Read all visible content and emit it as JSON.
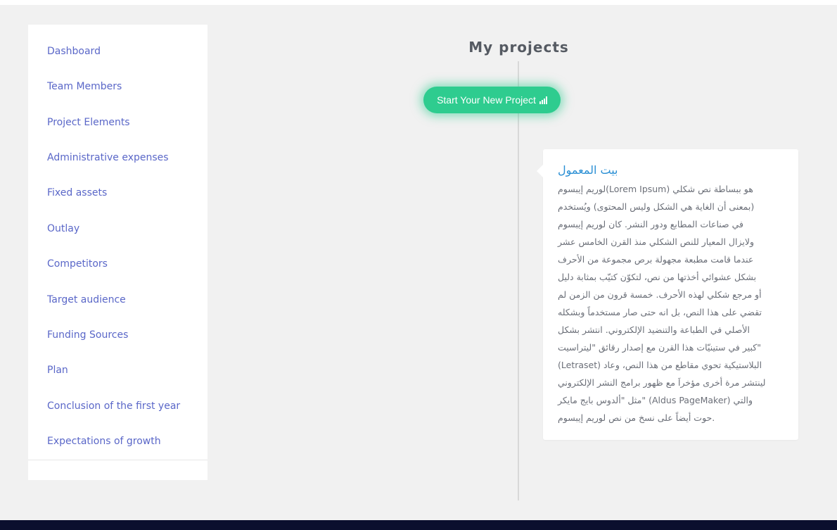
{
  "sidebar": {
    "items": [
      {
        "label": "Dashboard"
      },
      {
        "label": "Team Members"
      },
      {
        "label": "Project Elements"
      },
      {
        "label": "Administrative expenses"
      },
      {
        "label": "Fixed assets"
      },
      {
        "label": "Outlay"
      },
      {
        "label": "Competitors"
      },
      {
        "label": "Target audience"
      },
      {
        "label": "Funding Sources"
      },
      {
        "label": "Plan"
      },
      {
        "label": "Conclusion of the first year"
      },
      {
        "label": "Expectations of growth"
      }
    ]
  },
  "main": {
    "title": "My projects",
    "new_project_button": {
      "label": "Start Your New Project",
      "icon": "bar-chart-icon"
    },
    "project_card": {
      "title": "بيت المعمول",
      "body_lines": [
        "هو ببساطة نص شكلي (Lorem Ipsum)لوريم إيبسوم",
        "(بمعنى أن الغاية هي الشكل وليس المحتوى) ويُستخدم",
        "في صناعات المطابع ودور النشر. كان لوريم إيبسوم",
        "ولايزال المعيار للنص الشكلي منذ القرن الخامس عشر",
        "عندما قامت مطبعة مجهولة برص مجموعة من الأحرف",
        "بشكل عشوائي أخذتها من نص، لتكوّن كتيّب بمثابة دليل",
        "أو مرجع شكلي لهذه الأحرف. خمسة قرون من الزمن لم",
        "تقضي على هذا النص، بل انه حتى صار مستخدماً وبشكله",
        "الأصلي في الطباعة والتنضيد الإلكتروني. انتشر بشكل",
        "\"كبير في ستينيّات هذا القرن مع إصدار رقائق \"ليتراسيت",
        "البلاستيكية تحوي مقاطع من هذا النص، وعاد (Letraset)",
        "لينتشر مرة أخرى مؤخراَ مع ظهور برامج النشر الإلكتروني",
        "والتي (Aldus PageMaker) \"مثل \"ألدوس بايج مايكر",
        ".حوت أيضاً على نسخ من نص لوريم إيبسوم"
      ]
    }
  },
  "colors": {
    "background": "#f1f1f1",
    "sidebar_link": "#5a67c8",
    "button": "#2ecc8f",
    "card_title": "#2a8fd4",
    "footer": "#0b0f2e"
  }
}
